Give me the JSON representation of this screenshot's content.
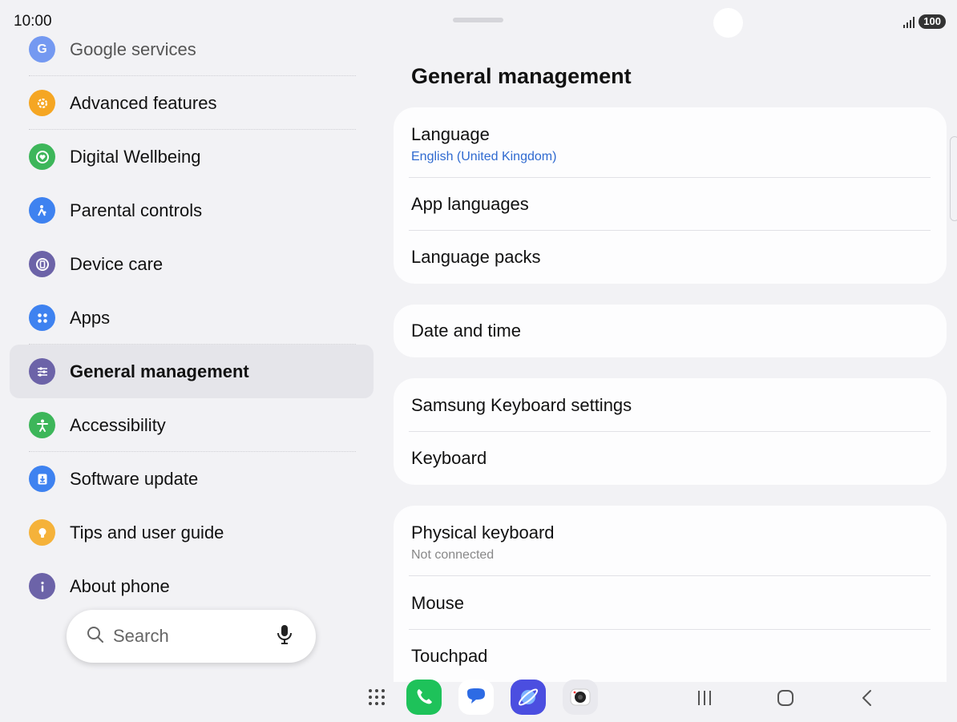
{
  "status_bar": {
    "time": "10:00",
    "battery": "100"
  },
  "sidebar": {
    "items": [
      {
        "label": "Google services",
        "icon": "google-icon",
        "color": "#4a7cf0",
        "state": "faded"
      },
      {
        "label": "Advanced features",
        "icon": "star-gear-icon",
        "color": "#f5a623"
      },
      {
        "label": "Digital Wellbeing",
        "icon": "heart-circle-icon",
        "color": "#3db65a"
      },
      {
        "label": "Parental controls",
        "icon": "parent-child-icon",
        "color": "#3e82f0"
      },
      {
        "label": "Device care",
        "icon": "device-care-icon",
        "color": "#6c63a8"
      },
      {
        "label": "Apps",
        "icon": "apps-grid-icon",
        "color": "#3e82f0"
      },
      {
        "label": "General management",
        "icon": "sliders-icon",
        "color": "#6c63a8",
        "state": "selected"
      },
      {
        "label": "Accessibility",
        "icon": "person-icon",
        "color": "#3db65a"
      },
      {
        "label": "Software update",
        "icon": "download-icon",
        "color": "#3e82f0"
      },
      {
        "label": "Tips and user guide",
        "icon": "lightbulb-icon",
        "color": "#f5b23a"
      },
      {
        "label": "About phone",
        "icon": "info-icon",
        "color": "#6c63a8"
      }
    ]
  },
  "search": {
    "placeholder": "Search"
  },
  "main": {
    "title": "General management",
    "groups": [
      {
        "rows": [
          {
            "title": "Language",
            "subtitle": "English (United Kingdom)"
          },
          {
            "title": "App languages"
          },
          {
            "title": "Language packs"
          }
        ]
      },
      {
        "rows": [
          {
            "title": "Date and time"
          }
        ]
      },
      {
        "rows": [
          {
            "title": "Samsung Keyboard settings"
          },
          {
            "title": "Keyboard"
          }
        ]
      },
      {
        "rows": [
          {
            "title": "Physical keyboard",
            "subtitle": "Not connected"
          },
          {
            "title": "Mouse"
          },
          {
            "title": "Touchpad"
          }
        ]
      }
    ]
  },
  "colors": {
    "background": "#f2f2f5",
    "card": "#fdfdfe",
    "accent_blue": "#2f6ad0",
    "selected_bg": "#e5e5ea"
  },
  "dock": {
    "apps": [
      "app-drawer-icon",
      "phone-icon",
      "messages-icon",
      "internet-icon",
      "camera-icon"
    ],
    "nav": [
      "recents-icon",
      "home-icon",
      "back-icon"
    ]
  }
}
